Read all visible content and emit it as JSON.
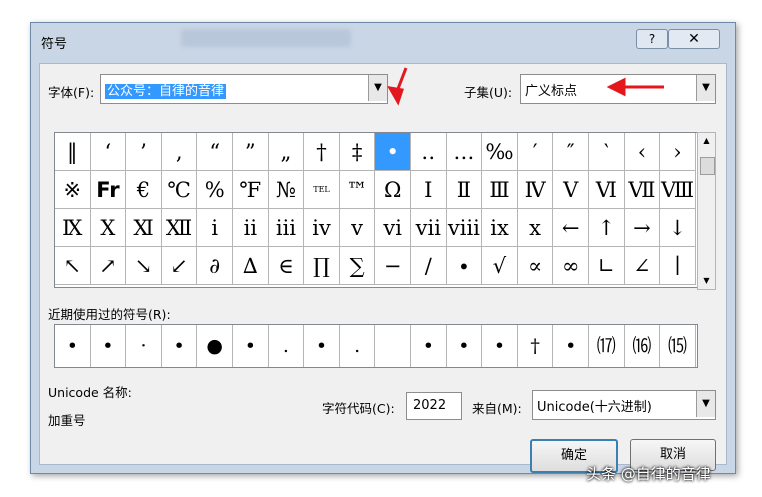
{
  "dialog": {
    "title": "符号"
  },
  "titlebar": {
    "help_label": "?",
    "close_label": "✕"
  },
  "font": {
    "label": "字体(F):",
    "value": "公众号：自律的音律"
  },
  "subset": {
    "label": "子集(U):",
    "value": "广义标点"
  },
  "symbols": [
    [
      "‖",
      "‘",
      "’",
      "‚",
      "“",
      "”",
      "„",
      "†",
      "‡",
      "•",
      "‥",
      "…",
      "‰",
      "′",
      "″",
      "‵",
      "‹",
      "›"
    ],
    [
      "※",
      "Fr",
      "€",
      "℃",
      "%",
      "℉",
      "№",
      "TEL",
      "™",
      "Ω",
      "Ⅰ",
      "Ⅱ",
      "Ⅲ",
      "Ⅳ",
      "Ⅴ",
      "Ⅵ",
      "Ⅶ",
      "Ⅷ"
    ],
    [
      "Ⅸ",
      "Ⅹ",
      "Ⅺ",
      "Ⅻ",
      "ⅰ",
      "ⅱ",
      "ⅲ",
      "ⅳ",
      "ⅴ",
      "ⅵ",
      "ⅶ",
      "ⅷ",
      "ⅸ",
      "ⅹ",
      "←",
      "↑",
      "→",
      "↓"
    ],
    [
      "↖",
      "↗",
      "↘",
      "↙",
      "∂",
      "∆",
      "∈",
      "∏",
      "∑",
      "−",
      "∕",
      "∙",
      "√",
      "∝",
      "∞",
      "∟",
      "∠",
      "∣"
    ]
  ],
  "selected_symbol": "•",
  "recent": {
    "label": "近期使用过的符号(R):",
    "items": [
      "•",
      "•",
      "·",
      "•",
      "●",
      "•",
      ".",
      "•",
      ".",
      "",
      "•",
      "•",
      "•",
      "†",
      "•",
      "⒄",
      "⒃",
      "⒂"
    ]
  },
  "unicode": {
    "name_label": "Unicode 名称:",
    "name_value": "加重号"
  },
  "charcode": {
    "label": "字符代码(C):",
    "value": "2022"
  },
  "from": {
    "label": "来自(M):",
    "value": "Unicode(十六进制)"
  },
  "buttons": {
    "ok": "确定",
    "cancel": "取消"
  },
  "watermark": "头条 @自律的音律",
  "colors": {
    "selection": "#3399ff",
    "annotation_arrow": "#e3171d",
    "frame": "#c9d6e6"
  }
}
